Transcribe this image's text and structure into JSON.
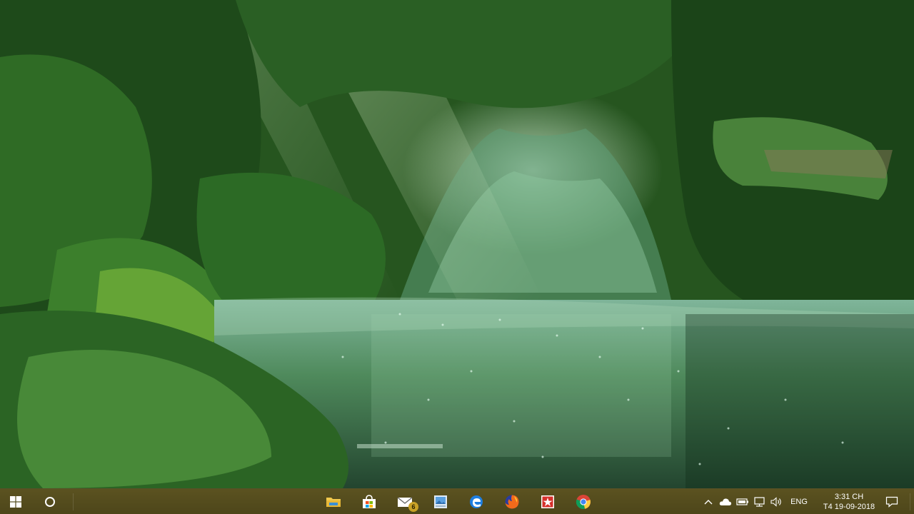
{
  "wallpaper": {
    "colors": {
      "foliage_dark": "#1f4a1d",
      "foliage_mid": "#3d7d37",
      "mist": "#cfeed5",
      "water": "#3f7a48"
    }
  },
  "taskbar": {
    "background": "#554d1d",
    "start_icon": "windows-logo-icon",
    "search_icon": "cortana-circle-icon",
    "pinned_apps": [
      {
        "name": "file-explorer",
        "icon": "folder-icon"
      },
      {
        "name": "microsoft-store",
        "icon": "store-bag-icon"
      },
      {
        "name": "mail",
        "icon": "mail-icon",
        "badge": "6"
      },
      {
        "name": "photos",
        "icon": "photos-icon"
      },
      {
        "name": "edge",
        "icon": "edge-icon"
      },
      {
        "name": "firefox",
        "icon": "firefox-icon"
      },
      {
        "name": "wps-office",
        "icon": "wps-icon"
      },
      {
        "name": "chrome",
        "icon": "chrome-icon"
      }
    ],
    "tray": {
      "chevron_icon": "chevron-up-icon",
      "icons": [
        "onedrive-cloud-icon",
        "battery-icon",
        "network-icon",
        "volume-icon"
      ],
      "language": "ENG",
      "time": "3:31 CH",
      "date": "T4 19-09-2018",
      "notification_icon": "action-center-icon"
    }
  }
}
